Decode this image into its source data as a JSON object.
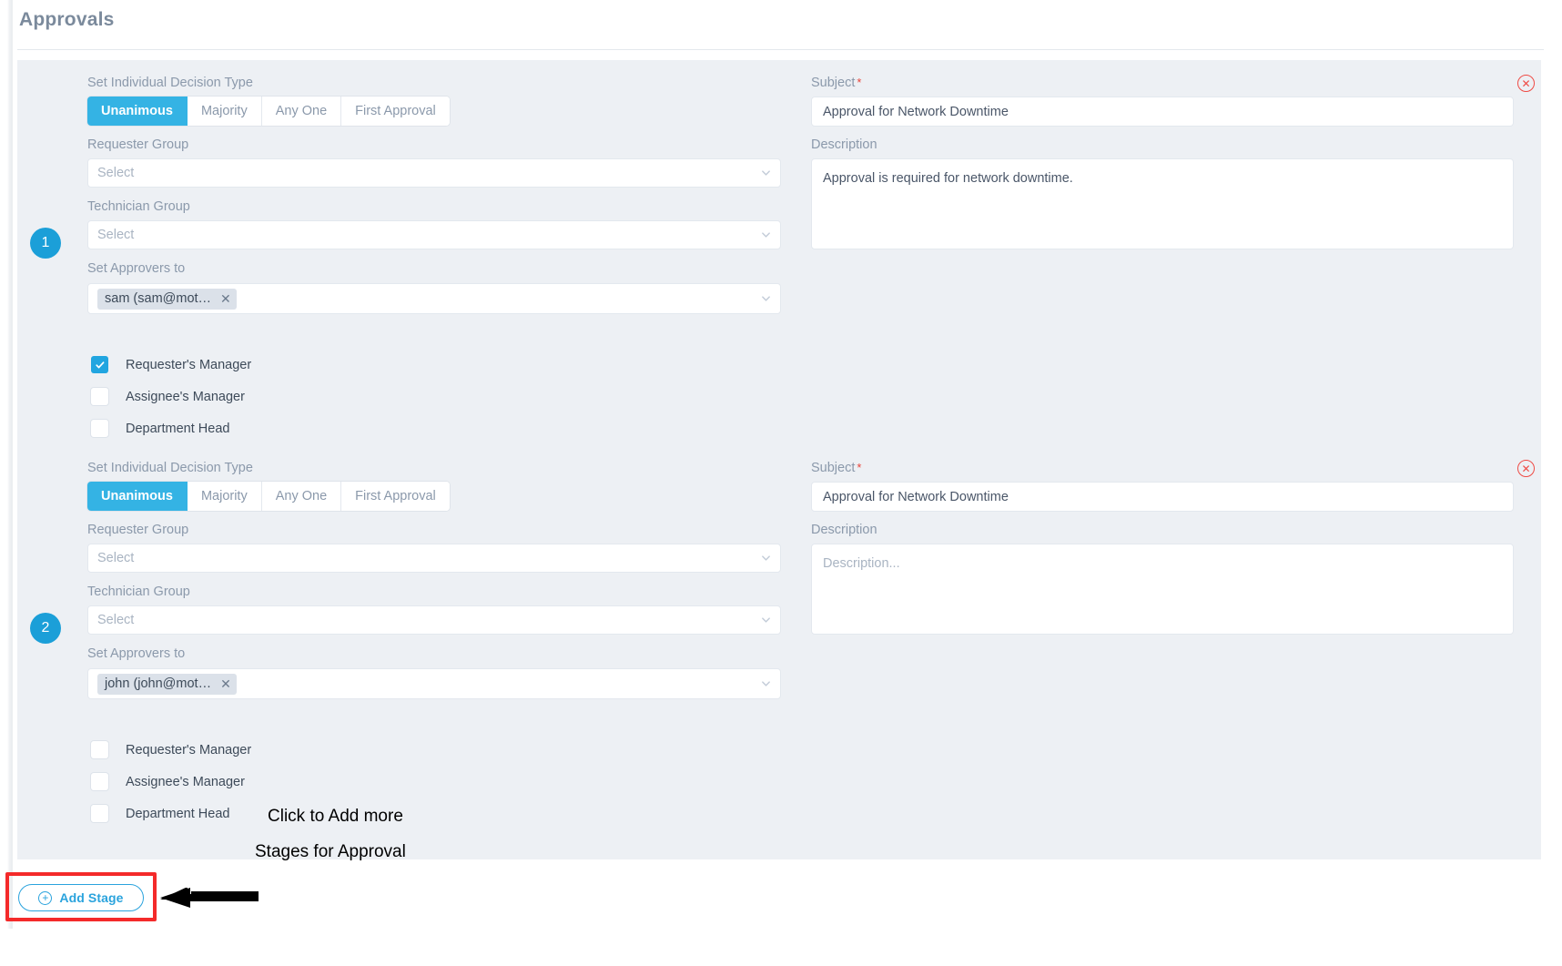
{
  "page": {
    "title": "Approvals"
  },
  "labels": {
    "decision_type": "Set Individual Decision Type",
    "requester_group": "Requester Group",
    "technician_group": "Technician Group",
    "set_approvers": "Set Approvers to",
    "subject": "Subject",
    "description": "Description",
    "required_mark": "*",
    "select_placeholder": "Select",
    "description_placeholder": "Description..."
  },
  "decision_types": [
    {
      "label": "Unanimous",
      "active": true
    },
    {
      "label": "Majority",
      "active": false
    },
    {
      "label": "Any One",
      "active": false
    },
    {
      "label": "First Approval",
      "active": false
    }
  ],
  "checkbox_labels": {
    "requesters_manager": "Requester's Manager",
    "assignees_manager": "Assignee's Manager",
    "department_head": "Department Head"
  },
  "stages": [
    {
      "number": "1",
      "decision_type_selected": "Unanimous",
      "requester_group_value": "Select",
      "technician_group_value": "Select",
      "approver_token": "sam (sam@mot…",
      "subject_value": "Approval for Network Downtime",
      "description_value": "Approval is required for network downtime.",
      "description_is_placeholder": false,
      "checkboxes": {
        "requesters_manager": true,
        "assignees_manager": false,
        "department_head": false
      }
    },
    {
      "number": "2",
      "decision_type_selected": "Unanimous",
      "requester_group_value": "Select",
      "technician_group_value": "Select",
      "approver_token": "john (john@mot…",
      "subject_value": "Approval for Network Downtime",
      "description_value": "Description...",
      "description_is_placeholder": true,
      "checkboxes": {
        "requesters_manager": false,
        "assignees_manager": false,
        "department_head": false
      }
    }
  ],
  "add_stage": {
    "label": "Add Stage",
    "icon": "plus-circle-icon"
  },
  "annotation": {
    "line1": "Click to Add more",
    "line2": "Stages for Approval"
  },
  "colors": {
    "accent_blue": "#34b3e4",
    "badge_blue": "#1b9fd8",
    "card_bg": "#edf0f4",
    "label_gray": "#8b99ab",
    "danger_red": "#ef4b45",
    "highlight_red": "#f42a2a",
    "link_blue": "#2aa3dd"
  }
}
